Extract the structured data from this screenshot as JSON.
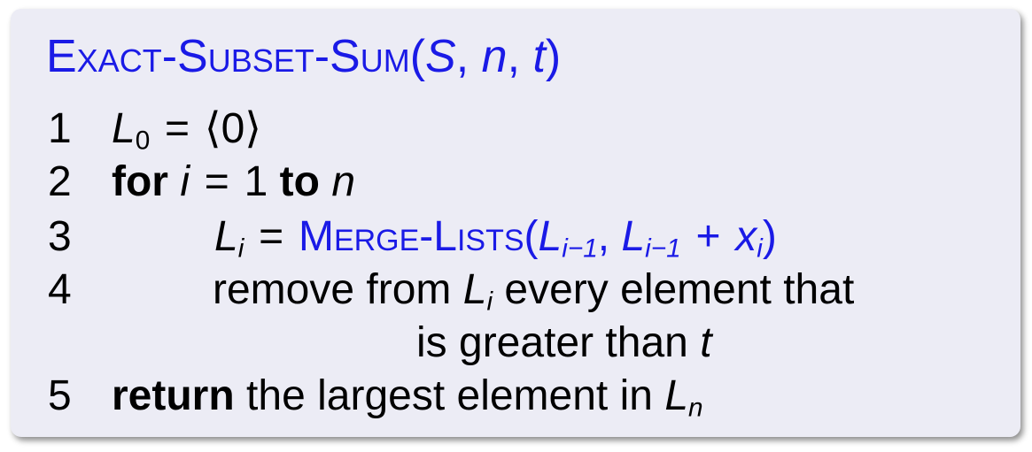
{
  "algorithm": {
    "name": "Exact-Subset-Sum",
    "params": {
      "p1": "S",
      "p2": "n",
      "p3": "t"
    }
  },
  "lines": [
    {
      "number": "1",
      "var": "L",
      "sub": "0",
      "op": "=",
      "value": "⟨0⟩"
    },
    {
      "number": "2",
      "kw_for": "for",
      "var": "i",
      "op": "=",
      "start": "1",
      "kw_to": "to",
      "end": "n"
    },
    {
      "number": "3",
      "var": "L",
      "sub": "i",
      "op": "=",
      "func": "Merge-Lists",
      "arg1_var": "L",
      "arg1_sub": "i−1",
      "arg2_var": "L",
      "arg2_sub": "i−1",
      "plus": "+",
      "arg2_x": "x",
      "arg2_xsub": "i"
    },
    {
      "number": "4",
      "text1": "remove from",
      "var": "L",
      "sub": "i",
      "text2": "every element that",
      "text3": "is greater than",
      "var2": "t"
    },
    {
      "number": "5",
      "kw_return": "return",
      "text": "the largest element in",
      "var": "L",
      "sub": "n"
    }
  ]
}
